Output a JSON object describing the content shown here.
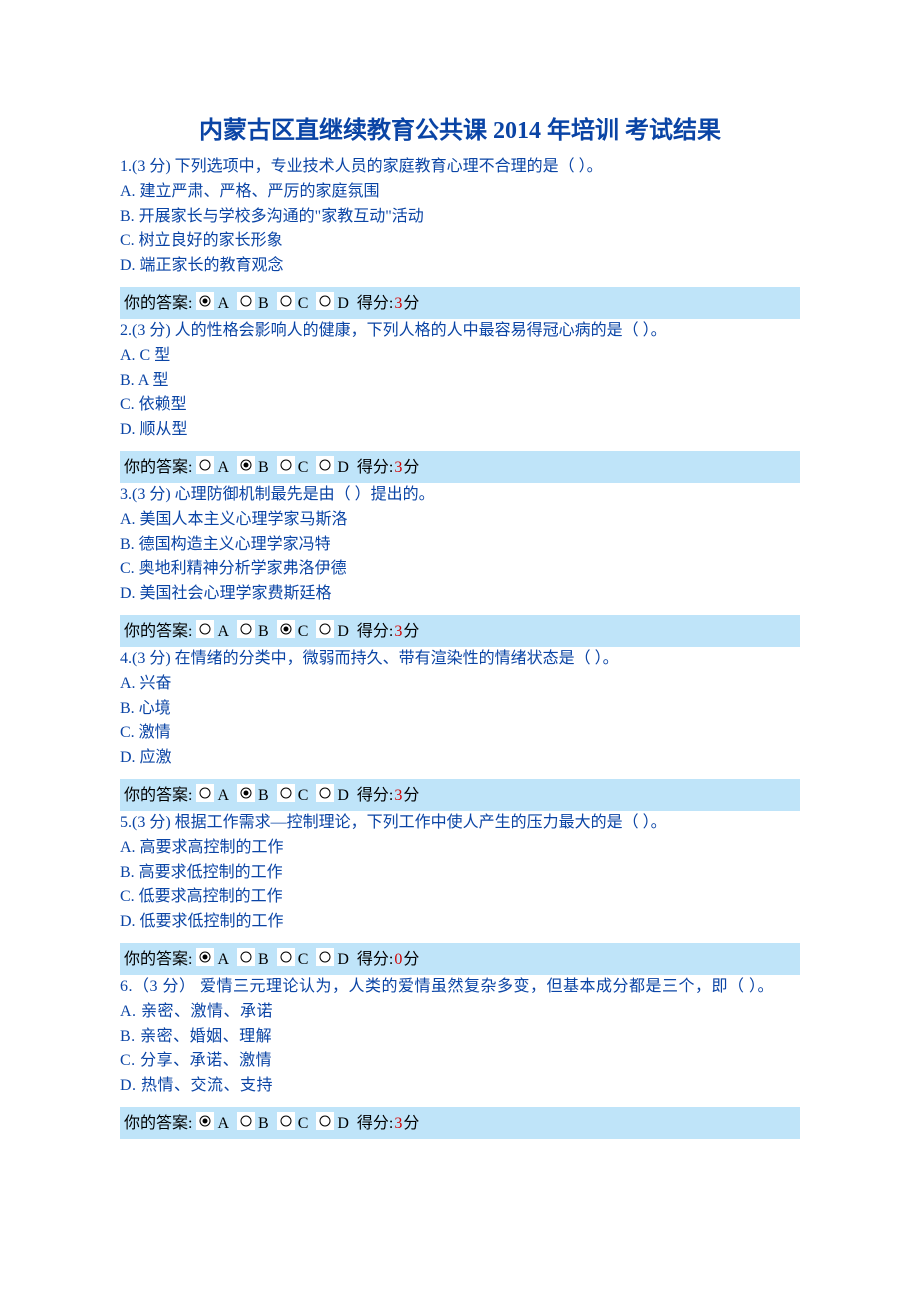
{
  "title": "内蒙古区直继续教育公共课 2014 年培训  考试结果",
  "answerLabel": "你的答案: ",
  "scoreLabel": " 得分: ",
  "scoreUnit": " 分",
  "letters": [
    "A",
    "B",
    "C",
    "D"
  ],
  "questions": [
    {
      "stem": "1.(3 分)  下列选项中，专业技术人员的家庭教育心理不合理的是（  ）。",
      "options": [
        "A.  建立严肃、严格、严厉的家庭氛围",
        "B.  开展家长与学校多沟通的\"家教互动\"活动",
        "C.  树立良好的家长形象",
        "D.  端正家长的教育观念"
      ],
      "selected": 0,
      "score": "3"
    },
    {
      "stem": "2.(3 分)  人的性格会影响人的健康，下列人格的人中最容易得冠心病的是（  ）。",
      "options": [
        "A. C 型",
        "B. A 型",
        "C.  依赖型",
        "D.  顺从型"
      ],
      "selected": 1,
      "score": "3"
    },
    {
      "stem": "3.(3 分)  心理防御机制最先是由（  ）提出的。",
      "options": [
        "A.  美国人本主义心理学家马斯洛",
        "B.  德国构造主义心理学家冯特",
        "C.  奥地利精神分析学家弗洛伊德",
        "D.  美国社会心理学家费斯廷格"
      ],
      "selected": 2,
      "score": "3"
    },
    {
      "stem": "4.(3 分)  在情绪的分类中，微弱而持久、带有渲染性的情绪状态是（  ）。",
      "options": [
        "A.  兴奋",
        "B.  心境",
        "C.  激情",
        "D.  应激"
      ],
      "selected": 1,
      "score": "3"
    },
    {
      "stem": "5.(3 分)  根据工作需求—控制理论，下列工作中使人产生的压力最大的是（  ）。",
      "options": [
        "A.  高要求高控制的工作",
        "B.  高要求低控制的工作",
        "C.  低要求高控制的工作",
        "D.  低要求低控制的工作"
      ],
      "selected": 0,
      "score": "0"
    },
    {
      "stem": "6.（3 分） 爱情三元理论认为，人类的爱情虽然复杂多变，但基本成分都是三个，即（  ）。",
      "options": [
        "A.  亲密、激情、承诺",
        "B.  亲密、婚姻、理解",
        "C.  分享、承诺、激情",
        "D.  热情、交流、支持"
      ],
      "selected": 0,
      "score": "3"
    }
  ]
}
